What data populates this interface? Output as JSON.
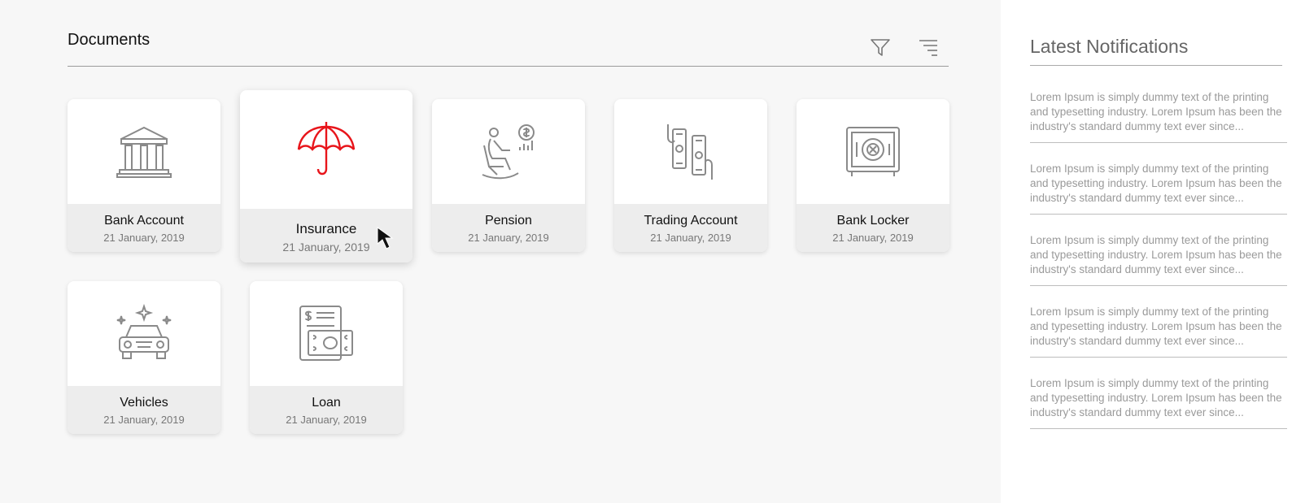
{
  "documents": {
    "title": "Documents",
    "filter_icon": "filter-icon",
    "sort_icon": "sort-icon",
    "cards": [
      {
        "name": "Bank Account",
        "date": "21 January, 2019",
        "icon": "bank-icon"
      },
      {
        "name": "Insurance",
        "date": "21 January, 2019",
        "icon": "umbrella-icon",
        "active": true
      },
      {
        "name": "Pension",
        "date": "21 January, 2019",
        "icon": "pension-icon"
      },
      {
        "name": "Trading Account",
        "date": "21 January, 2019",
        "icon": "trading-icon"
      },
      {
        "name": "Bank Locker",
        "date": "21 January, 2019",
        "icon": "safe-icon"
      },
      {
        "name": "Vehicles",
        "date": "21 January, 2019",
        "icon": "car-icon"
      },
      {
        "name": "Loan",
        "date": "21 January, 2019",
        "icon": "loan-icon"
      }
    ]
  },
  "notifications": {
    "title": "Latest Notifications",
    "items": [
      "Lorem Ipsum is simply dummy text of the printing and typesetting industry. Lorem Ipsum has been the industry's standard dummy text ever since...",
      "Lorem Ipsum is simply dummy text of the printing and typesetting industry. Lorem Ipsum has been the industry's standard dummy text ever since...",
      "Lorem Ipsum is simply dummy text of the printing and typesetting industry. Lorem Ipsum has been the industry's standard dummy text ever since...",
      "Lorem Ipsum is simply dummy text of the printing and typesetting industry. Lorem Ipsum has been the industry's standard dummy text ever since...",
      "Lorem Ipsum is simply dummy text of the printing and typesetting industry. Lorem Ipsum has been the industry's standard dummy text ever since..."
    ]
  },
  "colors": {
    "accent": "#e8151b",
    "icon_gray": "#8a8a8a"
  }
}
